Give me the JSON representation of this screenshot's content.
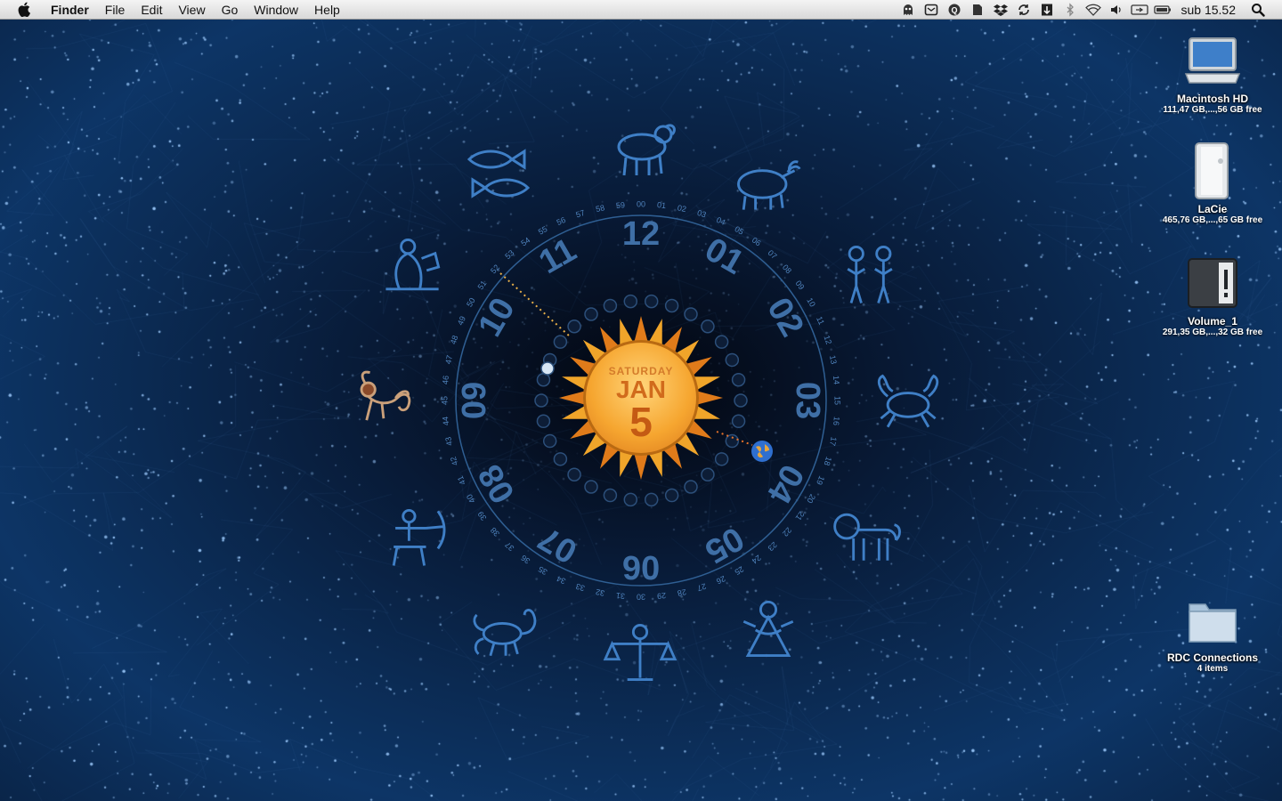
{
  "menubar": {
    "app_name": "Finder",
    "menus": [
      "File",
      "Edit",
      "View",
      "Go",
      "Window",
      "Help"
    ],
    "status_icons": [
      "ghost-icon",
      "mail-icon",
      "quicksilver-icon",
      "document-icon",
      "dropbox-icon",
      "sync-icon",
      "clipboard-icon",
      "bluetooth-icon",
      "wifi-icon",
      "volume-icon",
      "display-icon",
      "battery-icon"
    ],
    "clock": "sub 15.52"
  },
  "desktop_icons": [
    {
      "label": "Macintosh HD",
      "sub": "111,47 GB,...,56 GB free",
      "icon": "laptop-drive-icon"
    },
    {
      "label": "LaCie",
      "sub": "465,76 GB,...,65 GB free",
      "icon": "external-drive-icon"
    },
    {
      "label": "Volume_1",
      "sub": "291,35 GB,...,32 GB free",
      "icon": "network-drive-icon"
    },
    {
      "label": "RDC Connections",
      "sub": "4 items",
      "icon": "folder-icon"
    }
  ],
  "clock_widget": {
    "day": "SATURDAY",
    "month": "JAN",
    "date": "5",
    "hours": [
      "12",
      "01",
      "02",
      "03",
      "04",
      "05",
      "06",
      "07",
      "08",
      "09",
      "10",
      "11"
    ],
    "minutes": [
      "00",
      "01",
      "02",
      "03",
      "04",
      "05",
      "06",
      "07",
      "08",
      "09",
      "10",
      "11",
      "12",
      "13",
      "14",
      "15",
      "16",
      "17",
      "18",
      "19",
      "20",
      "21",
      "22",
      "23",
      "24",
      "25",
      "26",
      "27",
      "28",
      "29",
      "30",
      "31",
      "32",
      "33",
      "34",
      "35",
      "36",
      "37",
      "38",
      "39",
      "40",
      "41",
      "42",
      "43",
      "44",
      "45",
      "46",
      "47",
      "48",
      "49",
      "50",
      "51",
      "52",
      "53",
      "54",
      "55",
      "56",
      "57",
      "58",
      "59"
    ]
  },
  "colors": {
    "accent_blue": "#3f7fc6",
    "sun_orange": "#f39a22",
    "dotted_line": "#e8b04a"
  }
}
